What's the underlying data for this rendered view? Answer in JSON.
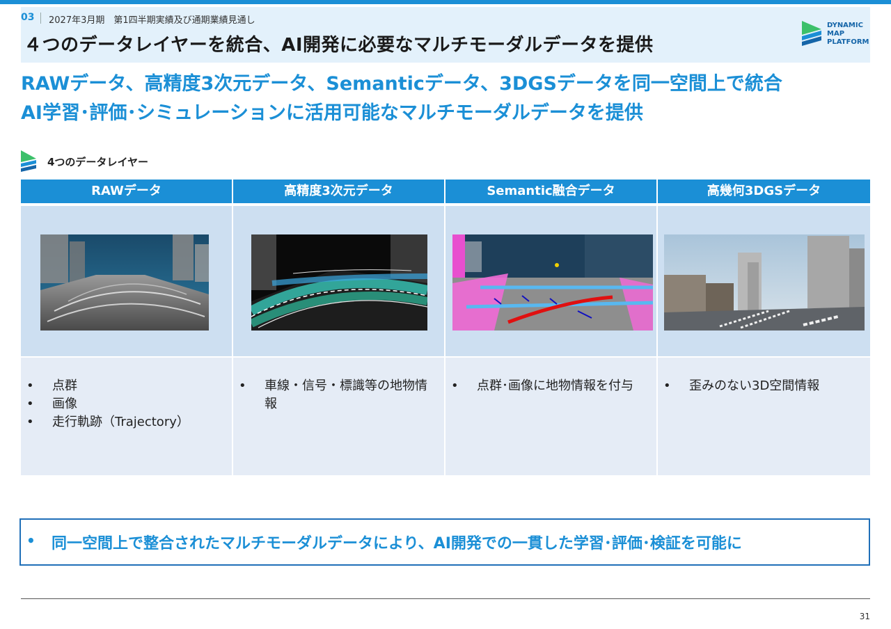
{
  "header": {
    "section_number": "03",
    "section_title": "2027年3月期　第1四半期実績及び通期業績見通し",
    "page_title": "４つのデータレイヤーを統合、AI開発に必要なマルチモーダルデータを提供",
    "logo_lines": [
      "DYNAMIC",
      "MAP",
      "PLATFORM"
    ]
  },
  "headlines": [
    "RAWデータ、高精度3次元データ、Semanticデータ、3DGSデータを同一空間上で統合",
    "AI学習･評価･シミュレーションに活用可能なマルチモーダルデータを提供"
  ],
  "layers_label": "4つのデータレイヤー",
  "columns": [
    {
      "header": "RAWデータ",
      "items": [
        "点群",
        "画像",
        "走行軌跡（Trajectory）"
      ]
    },
    {
      "header": "高精度3次元データ",
      "items": [
        "車線・信号・標識等の地物情報"
      ]
    },
    {
      "header": "Semantic融合データ",
      "items": [
        "点群･画像に地物情報を付与"
      ]
    },
    {
      "header": "高幾何3DGSデータ",
      "items": [
        "歪みのない3D空間情報"
      ]
    }
  ],
  "bullet_char": "•",
  "callout": "同一空間上で整合されたマルチモーダルデータにより、AI開発での一貫した学習･評価･検証を可能に",
  "page_number": "31",
  "colors": {
    "accent": "#1b8fd6",
    "header_bg": "#e3f1fb",
    "image_cell": "#cddff1",
    "text_cell": "#e5ecf6",
    "callout_border": "#1f6fb8"
  }
}
